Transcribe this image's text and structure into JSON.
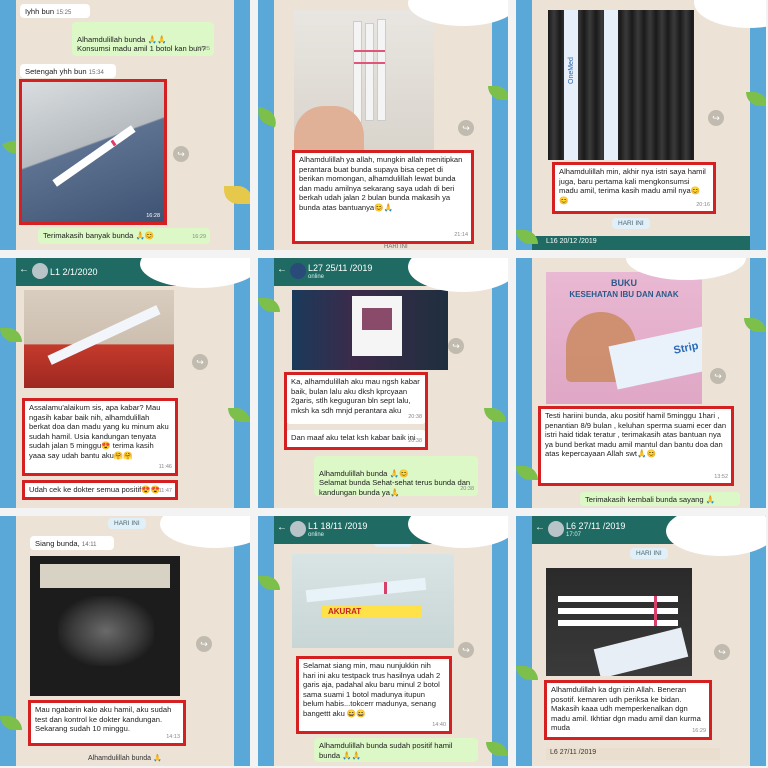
{
  "p1": {
    "msg_top": "Iyhh bun",
    "msg_top_time": "15:25",
    "msg_reply": "Alhamdulillah bunda 🙏🙏\nKonsumsi madu amil 1 botol kan bun?",
    "msg_reply_time": "15:25",
    "msg_half": "Setengah yhh bun",
    "msg_half_time": "15:34",
    "photo_time": "16:28",
    "thanks": "Terimakasih banyak bunda 🙏😊",
    "thanks_time": "16:29"
  },
  "p2": {
    "text": "Alhamdulillah ya allah, mungkin allah menitipkan perantara buat bunda supaya bisa cepet di berikan momongan, alhamdulillah lewat bunda dan madu amilnya sekarang saya udah di beri berkah udah jalan 2 bulan bunda makasih ya bunda atas bantuanya😊🙏",
    "time": "21:14",
    "footer": "HARI INI"
  },
  "p3": {
    "strip_label": "OneMed",
    "text": "Alhamdulillah min, akhir nya istri saya hamil juga, baru pertama kali mengkonsumsi madu amil, terima kasih madu amil nya😊😊",
    "time": "20:16",
    "chip": "HARI INI",
    "next_header": "L16 20/12 /2019"
  },
  "p4": {
    "header_title": "L1 2/1/2020",
    "text": "Assalamu'alaikum sis, apa kabar? Mau ngasih kabar baik nih, alhamdulillah berkat doa dan madu yang ku minum aku sudah hamil. Usia kandungan tenyata sudah jalan 5 minggu😍 terima kasih yaaa say udah bantu aku🤗🤗",
    "time": "11:46",
    "text2": "Udah cek ke dokter semua positif😍😍",
    "time2": "11:47"
  },
  "p5": {
    "header_title": "L27 25/11 /2019",
    "header_sub": "online",
    "text": "Ka, alhamdulillah aku mau ngsh kabar baik, bulan lalu aku dksh kprcyaan 2garis, stlh keguguran bln sept lalu, mksh ka sdh mnjd perantara aku",
    "time": "20:38",
    "text2": "Dan maaf aku telat ksh kabar baik ini",
    "time2": "20:38",
    "reply": "Alhamdulillah bunda 🙏😊\nSelamat bunda Sehat-sehat terus bunda dan kandungan bunda ya🙏",
    "reply_time": "20:38"
  },
  "p6": {
    "book_line1": "BUKU",
    "book_line2": "KESEHATAN IBU DAN ANAK",
    "strip_word": "Strip",
    "text": "Testi hariini bunda, aku positif hamil 5minggu 1hari , penantian 8/9 bulan , keluhan sperma suami ecer dan istri haid tidak teratur , terimakasih atas bantuan nya ya bund berkat madu amil mantul dan bantu doa dan atas kepercayaan Allah swt🙏😊",
    "time": "13:52",
    "reply": "Terimakasih kembali bunda sayang 🙏"
  },
  "p7": {
    "chip": "HARI INI",
    "msg": "Siang bunda,",
    "msg_time": "14:11",
    "text": "Mau ngabarin kalo aku hamil, aku sudah test dan kontrol ke dokter kandungan. Sekarang sudah 10 minggu.",
    "time": "14:13",
    "footer": "Alhamdulillah bunda 🙏"
  },
  "p8": {
    "header_title": "L1 18/11 /2019",
    "header_sub": "online",
    "chip": "HARI INI",
    "strip_label": "AKURAT",
    "text": "Selamat siang min, mau nunjukkin nih hari ini aku testpack trus hasilnya udah 2 garis aja, padahal aku baru minul 2 botol sama suami 1 botol madunya itupun belum habis...tokcerr madunya, senang bangettt aku 😄😄",
    "time": "14:40",
    "reply": "Alhamdulillah bunda sudah positif hamil bunda 🙏🙏"
  },
  "p9": {
    "header_title": "L6 27/11 /2019",
    "header_sub": "17:07",
    "chip": "HARI INI",
    "text": "Alhamdulillah ka dgn izin Allah. Beneran posotif. kemaren udh periksa ke bidan. Makasih kaaa udh memperkenalkan dgn madu amil. Ikhtiar dgn madu amil dan kurma muda",
    "time": "16:29",
    "next_header": "L6 27/11 /2019"
  },
  "colors": {
    "frame_blue": "#5aa8d8",
    "chat_bg": "#ece3d6",
    "outgoing_bubble": "#dcf8c6",
    "highlight_red": "#d42020",
    "header_teal": "#1f6b63"
  }
}
